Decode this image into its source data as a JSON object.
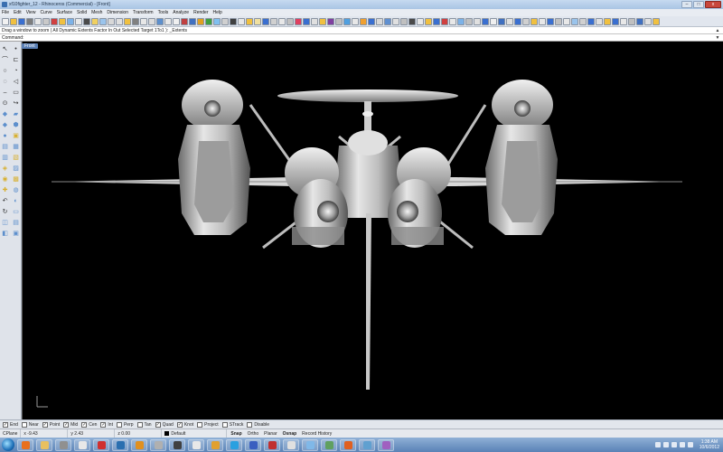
{
  "window": {
    "title": "xf10fighter_12 - Rhinoceros (Commercial) - [Front]",
    "buttons": [
      "–",
      "□",
      "x"
    ]
  },
  "menus": [
    "File",
    "Edit",
    "View",
    "Curve",
    "Surface",
    "Solid",
    "Mesh",
    "Dimension",
    "Transform",
    "Tools",
    "Analyze",
    "Render",
    "Help"
  ],
  "toolbar": {
    "icon_colors": [
      "#f2f2f2",
      "#f0c040",
      "#3a6fd0",
      "#7d7d7d",
      "#e8e8e8",
      "#c9c9c9",
      "#d04040",
      "#f0c040",
      "#7cb2e8",
      "#e8e8e8",
      "#4a4a4a",
      "#f0d060",
      "#9ac4ec",
      "#d8d8d8",
      "#e0e0e0",
      "#f0c040",
      "#808080",
      "#e8e8e8",
      "#dcdcdc",
      "#5d8fcc",
      "#e8e8e8",
      "#f0f0f0",
      "#c04040",
      "#4070c0",
      "#e0a020",
      "#40a040",
      "#80c0f0",
      "#d0d0d0",
      "#404040",
      "#e8e8e8",
      "#f0c040",
      "#f0e0a0",
      "#3a6fd0",
      "#d0d0d0",
      "#e8e8e8",
      "#c0c0c0",
      "#e04060",
      "#3a6fd0",
      "#e0e0e0",
      "#f0c040",
      "#8040a0",
      "#c0c0c0",
      "#50a0e0",
      "#e8e8e8",
      "#f0a030",
      "#3a6fd0",
      "#d8d8d8",
      "#6090d0",
      "#e0e0e0",
      "#c0c0c0",
      "#4a4a4a",
      "#e8e8e8",
      "#f0c040",
      "#3a6fd0",
      "#d04040",
      "#e8e8e8",
      "#7cb2e8",
      "#c0c0c0",
      "#e0e0e0",
      "#3a6fd0",
      "#f0f0f0",
      "#4070c0",
      "#e0e0e0",
      "#3a6fd0",
      "#d0d0d0",
      "#f0c040",
      "#e8e8e8",
      "#3a6fd0",
      "#c0c0c0",
      "#e8e8e8",
      "#9ac4ec",
      "#d0d0d0",
      "#3a6fd0",
      "#e0e0e0",
      "#f0c040",
      "#3a6fd0",
      "#e8e8e8",
      "#c0c0c0",
      "#4070c0",
      "#e0e0e0",
      "#f0c040"
    ]
  },
  "command": {
    "history": "Drag a window to zoom ( All  Dynamic  Extents  Factor  In  Out  Selected  Target  1To1 ): _Extents",
    "prompt_label": "Command:",
    "prompt_value": ""
  },
  "palette": {
    "icons": [
      {
        "glyph": "↖",
        "color": "#333333"
      },
      {
        "glyph": "•",
        "color": "#333333"
      },
      {
        "glyph": "⌒",
        "color": "#333333"
      },
      {
        "glyph": "⊏",
        "color": "#333333"
      },
      {
        "glyph": "○",
        "color": "#333333"
      },
      {
        "glyph": "◔",
        "color": "#333333"
      },
      {
        "glyph": "◌",
        "color": "#333333"
      },
      {
        "glyph": "◁",
        "color": "#333333"
      },
      {
        "glyph": "⌢",
        "color": "#333333"
      },
      {
        "glyph": "▭",
        "color": "#333333"
      },
      {
        "glyph": "⊙",
        "color": "#333333"
      },
      {
        "glyph": "↪",
        "color": "#333333"
      },
      {
        "glyph": "◆",
        "color": "#5d8fcc"
      },
      {
        "glyph": "▰",
        "color": "#5d8fcc"
      },
      {
        "glyph": "◆",
        "color": "#5d8fcc"
      },
      {
        "glyph": "⬢",
        "color": "#5d8fcc"
      },
      {
        "glyph": "●",
        "color": "#5d8fcc"
      },
      {
        "glyph": "▣",
        "color": "#d8b030"
      },
      {
        "glyph": "▤",
        "color": "#5d8fcc"
      },
      {
        "glyph": "▦",
        "color": "#5d8fcc"
      },
      {
        "glyph": "▥",
        "color": "#5d8fcc"
      },
      {
        "glyph": "▧",
        "color": "#d8b030"
      },
      {
        "glyph": "◈",
        "color": "#d8b030"
      },
      {
        "glyph": "▨",
        "color": "#5d8fcc"
      },
      {
        "glyph": "◉",
        "color": "#d8b030"
      },
      {
        "glyph": "▩",
        "color": "#d8b030"
      },
      {
        "glyph": "✚",
        "color": "#d8b030"
      },
      {
        "glyph": "◍",
        "color": "#5d8fcc"
      },
      {
        "glyph": "↶",
        "color": "#333333"
      },
      {
        "glyph": "◐",
        "color": "#5d8fcc"
      },
      {
        "glyph": "↻",
        "color": "#333333"
      },
      {
        "glyph": "▭",
        "color": "#5d8fcc"
      },
      {
        "glyph": "◫",
        "color": "#5d8fcc"
      },
      {
        "glyph": "▤",
        "color": "#5d8fcc"
      },
      {
        "glyph": "◧",
        "color": "#5d8fcc"
      },
      {
        "glyph": "▣",
        "color": "#5d8fcc"
      }
    ]
  },
  "viewport": {
    "tab_label": "Front",
    "background": "#000000",
    "axis_labels": {
      "x": "x",
      "y": "y"
    }
  },
  "osnap": [
    {
      "label": "End",
      "checked": true
    },
    {
      "label": "Near",
      "checked": false
    },
    {
      "label": "Point",
      "checked": true
    },
    {
      "label": "Mid",
      "checked": true
    },
    {
      "label": "Cen",
      "checked": true
    },
    {
      "label": "Int",
      "checked": true
    },
    {
      "label": "Perp",
      "checked": false
    },
    {
      "label": "Tan",
      "checked": false
    },
    {
      "label": "Quad",
      "checked": true
    },
    {
      "label": "Knot",
      "checked": true
    },
    {
      "label": "Project",
      "checked": false
    },
    {
      "label": "STrack",
      "checked": false
    },
    {
      "label": "Disable",
      "checked": false
    }
  ],
  "status": {
    "cplane": "CPlane",
    "x": "x -9.43",
    "y": "y 2.43",
    "z": "z 0.00",
    "layer": "Default",
    "toggles": [
      {
        "label": "Snap",
        "on": true
      },
      {
        "label": "Ortho",
        "on": false
      },
      {
        "label": "Planar",
        "on": false
      },
      {
        "label": "Osnap",
        "on": true
      },
      {
        "label": "Record History",
        "on": false
      }
    ]
  },
  "taskbar": {
    "apps": [
      {
        "name": "firefox",
        "color": "#e8701c"
      },
      {
        "name": "explorer",
        "color": "#e8c060"
      },
      {
        "name": "rhino",
        "color": "#909090"
      },
      {
        "name": "media",
        "color": "#e8e8e8"
      },
      {
        "name": "ruby",
        "color": "#d03030"
      },
      {
        "name": "photoshop",
        "color": "#2a6fb0"
      },
      {
        "name": "illustrator",
        "color": "#e09020"
      },
      {
        "name": "shadow",
        "color": "#b0b0b0"
      },
      {
        "name": "zbrush",
        "color": "#404040"
      },
      {
        "name": "sketchbook",
        "color": "#e8e8e8"
      },
      {
        "name": "vlc",
        "color": "#e0a030"
      },
      {
        "name": "skype",
        "color": "#2aa0e0"
      },
      {
        "name": "word",
        "color": "#3a5fc0"
      },
      {
        "name": "filezilla",
        "color": "#c03030"
      },
      {
        "name": "gallery",
        "color": "#e0e0e0"
      },
      {
        "name": "notepad",
        "color": "#80b8e8"
      },
      {
        "name": "winamp",
        "color": "#60a060"
      },
      {
        "name": "keyshot",
        "color": "#e06020"
      },
      {
        "name": "network",
        "color": "#60a0d0"
      },
      {
        "name": "misc",
        "color": "#a060c0"
      }
    ],
    "time": "1:38 AM",
    "date": "10/6/2012"
  }
}
